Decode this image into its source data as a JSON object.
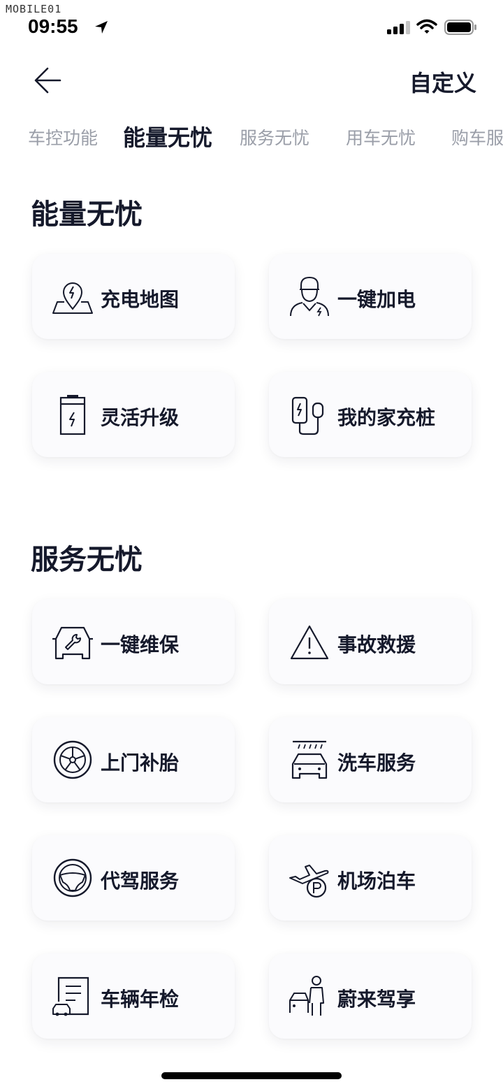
{
  "watermark": "MOBILE01",
  "status_bar": {
    "time": "09:55",
    "location_icon": "location-arrow-icon",
    "signal_icon": "cellular-signal-icon",
    "wifi_icon": "wifi-icon",
    "battery_icon": "battery-icon"
  },
  "header": {
    "back_icon": "arrow-left-icon",
    "customize_label": "自定义"
  },
  "tabs": [
    {
      "label": "车控功能",
      "active": false
    },
    {
      "label": "能量无忧",
      "active": true
    },
    {
      "label": "服务无忧",
      "active": false
    },
    {
      "label": "用车无忧",
      "active": false
    },
    {
      "label": "购车服",
      "active": false
    }
  ],
  "sections": [
    {
      "title": "能量无忧",
      "items": [
        {
          "label": "充电地图",
          "icon": "map-charging-pin-icon"
        },
        {
          "label": "一键加电",
          "icon": "service-staff-icon"
        },
        {
          "label": "灵活升级",
          "icon": "battery-upgrade-icon"
        },
        {
          "label": "我的家充桩",
          "icon": "home-charger-icon"
        }
      ]
    },
    {
      "title": "服务无忧",
      "items": [
        {
          "label": "一键维保",
          "icon": "car-wrench-icon"
        },
        {
          "label": "事故救援",
          "icon": "warning-triangle-icon"
        },
        {
          "label": "上门补胎",
          "icon": "tire-icon"
        },
        {
          "label": "洗车服务",
          "icon": "car-wash-icon"
        },
        {
          "label": "代驾服务",
          "icon": "steering-wheel-icon"
        },
        {
          "label": "机场泊车",
          "icon": "airplane-parking-icon"
        },
        {
          "label": "车辆年检",
          "icon": "inspection-document-icon"
        },
        {
          "label": "蔚来驾享",
          "icon": "chauffeur-car-icon"
        }
      ]
    }
  ]
}
